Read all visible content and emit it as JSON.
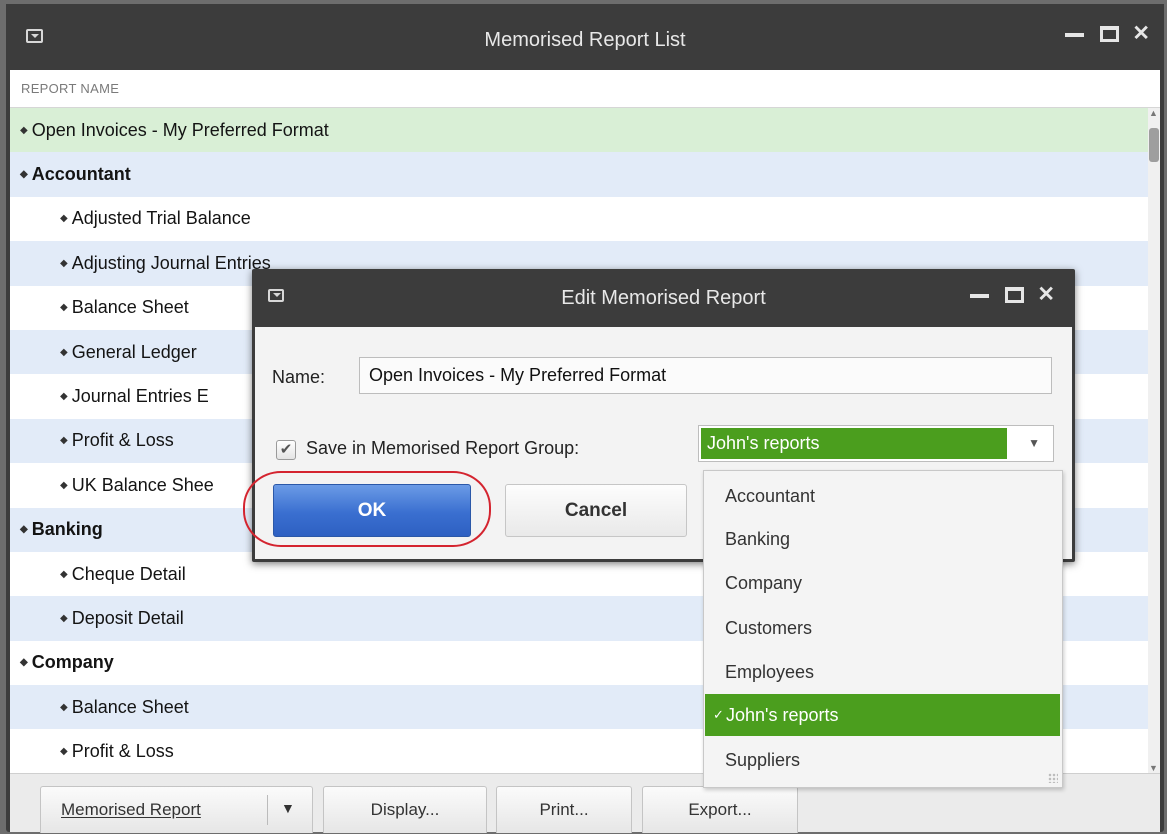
{
  "main_window": {
    "title": "Memorised Report List",
    "column_header": "REPORT NAME",
    "rows": [
      {
        "label": "Open Invoices - My Preferred Format",
        "kind": "level0",
        "bg": "selected"
      },
      {
        "label": "Accountant",
        "kind": "group",
        "bg": "alt"
      },
      {
        "label": "Adjusted Trial Balance",
        "kind": "child",
        "bg": "plain"
      },
      {
        "label": "Adjusting Journal Entries",
        "kind": "child",
        "bg": "alt"
      },
      {
        "label": "Balance Sheet",
        "kind": "child",
        "bg": "plain"
      },
      {
        "label": "General Ledger",
        "kind": "child",
        "bg": "alt"
      },
      {
        "label": "Journal Entries E",
        "kind": "child",
        "bg": "plain"
      },
      {
        "label": "Profit & Loss",
        "kind": "child",
        "bg": "alt"
      },
      {
        "label": "UK Balance Shee",
        "kind": "child",
        "bg": "plain"
      },
      {
        "label": "Banking",
        "kind": "group",
        "bg": "alt"
      },
      {
        "label": "Cheque Detail",
        "kind": "child",
        "bg": "plain"
      },
      {
        "label": "Deposit Detail",
        "kind": "child",
        "bg": "alt"
      },
      {
        "label": "Company",
        "kind": "group",
        "bg": "plain"
      },
      {
        "label": "Balance Sheet",
        "kind": "child",
        "bg": "alt"
      },
      {
        "label": "Profit & Loss",
        "kind": "child",
        "bg": "plain"
      }
    ],
    "bottom_buttons": {
      "memorised_report": "Memorised Report",
      "display": "Display...",
      "print": "Print...",
      "export": "Export..."
    }
  },
  "dialog": {
    "title": "Edit Memorised Report",
    "name_label": "Name:",
    "name_value": "Open Invoices - My Preferred Format",
    "group_checkbox_label": "Save in Memorised Report Group:",
    "group_checked": true,
    "group_selected": "John's reports",
    "ok_label": "OK",
    "cancel_label": "Cancel"
  },
  "dropdown": {
    "options": [
      "Accountant",
      "Banking",
      "Company",
      "Customers",
      "Employees",
      "John's reports",
      "Suppliers"
    ],
    "selected_index": 5
  },
  "colors": {
    "title_bar": "#3c3c3c",
    "row_alt": "#e2ebf8",
    "row_selected": "#d9efd6",
    "accent_green": "#4b9e1e",
    "ok_blue": "#3a6fd0",
    "highlight_ring": "#d4242f"
  },
  "icons": {
    "system_menu": "system-menu-icon",
    "minimize": "minimize-icon",
    "maximize": "maximize-icon",
    "close": "close-icon",
    "row_bullet": "diamond-bullet-icon",
    "dropdown": "chevron-down-icon",
    "check": "checkmark-icon"
  }
}
